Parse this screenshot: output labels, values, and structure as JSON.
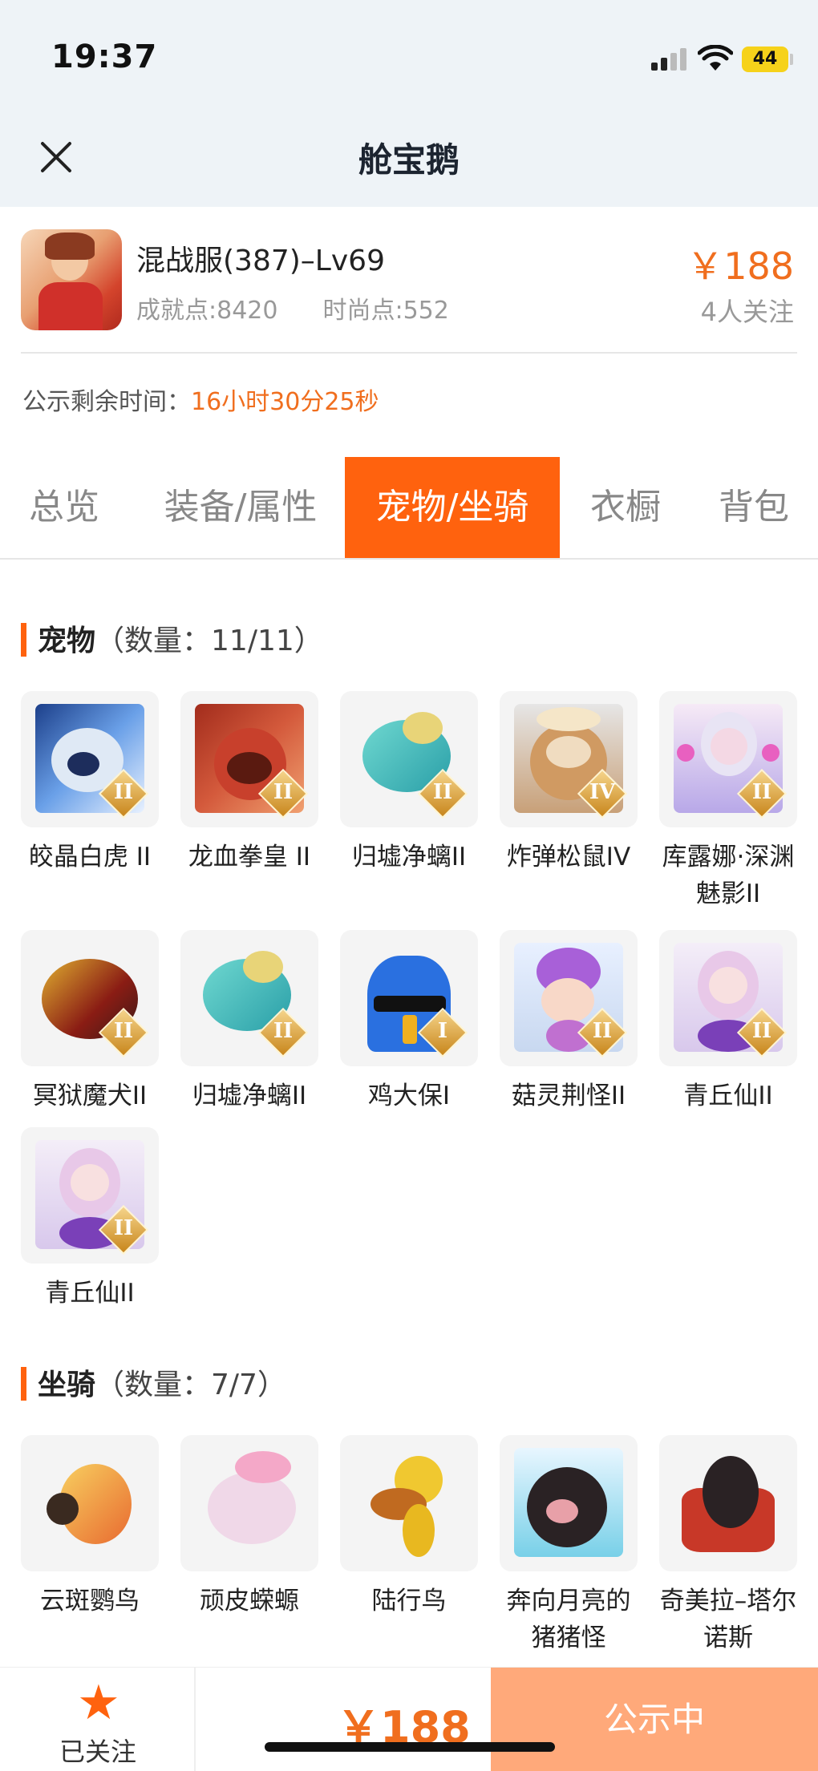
{
  "status_bar": {
    "time": "19:37",
    "battery": "44"
  },
  "nav": {
    "title": "舱宝鹅"
  },
  "product": {
    "title": "混战服(387)–Lv69",
    "achievement": "成就点:8420",
    "fashion": "时尚点:552",
    "price": "￥188",
    "followers": "4人关注"
  },
  "notice": {
    "label": "公示剩余时间：",
    "time": "16小时30分25秒"
  },
  "tabs": [
    "总览",
    "装备/属性",
    "宠物/坐骑",
    "衣橱",
    "背包"
  ],
  "active_tab": "宠物/坐骑",
  "pets_section": {
    "title": "宠物",
    "count": "（数量：11/11）"
  },
  "pets": [
    {
      "name": "皎晶白虎 II",
      "tier": "II"
    },
    {
      "name": "龙血拳皇 II",
      "tier": "II"
    },
    {
      "name": "归墟净螭II",
      "tier": "II"
    },
    {
      "name": "炸弹松鼠IV",
      "tier": "IV"
    },
    {
      "name": "库露娜·深渊魅影II",
      "tier": "II"
    },
    {
      "name": "冥狱魔犬II",
      "tier": "II"
    },
    {
      "name": "归墟净螭II",
      "tier": "II"
    },
    {
      "name": "鸡大保I",
      "tier": "I"
    },
    {
      "name": "菇灵荆怪II",
      "tier": "II"
    },
    {
      "name": "青丘仙II",
      "tier": "II"
    },
    {
      "name": "青丘仙II",
      "tier": "II"
    }
  ],
  "mounts_section": {
    "title": "坐骑",
    "count": "（数量：7/7）"
  },
  "mounts": [
    {
      "name": "云斑鹦鸟"
    },
    {
      "name": "顽皮蝾螈"
    },
    {
      "name": "陆行鸟"
    },
    {
      "name": "奔向月亮的猪猪怪"
    },
    {
      "name": "奇美拉–塔尔诺斯"
    }
  ],
  "bottom_bar": {
    "follow_label": "已关注",
    "price": "￥188",
    "status_button": "公示中"
  },
  "colors": {
    "accent": "#ff620e",
    "price": "#f06e1e",
    "status_button": "#ffa97a"
  }
}
